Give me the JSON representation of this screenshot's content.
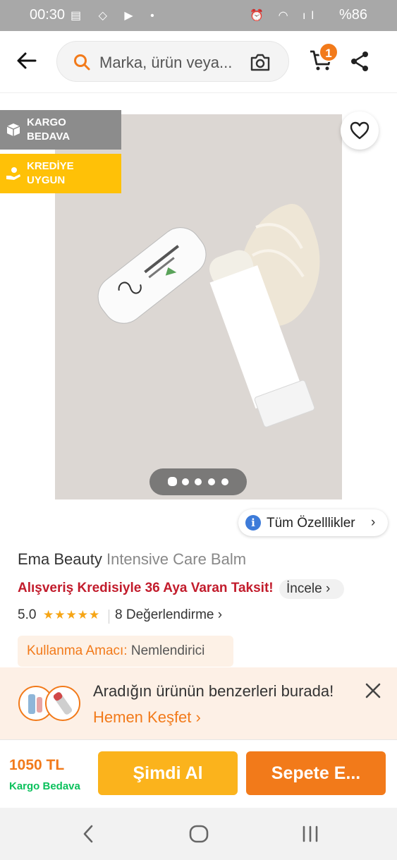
{
  "status_bar": {
    "time": "00:30",
    "battery": "%86"
  },
  "search": {
    "placeholder": "Marka, ürün veya..."
  },
  "cart": {
    "count": "1"
  },
  "badges": {
    "free_shipping_line1": "KARGO",
    "free_shipping_line2": "BEDAVA",
    "credit_line1": "KREDİYE",
    "credit_line2": "UYGUN"
  },
  "gallery": {
    "image_count": 5,
    "active_index": 0
  },
  "features_button": "Tüm Özelllikler",
  "product": {
    "brand": "Ema Beauty",
    "name": "Intensive Care Balm",
    "credit_text": "Alışveriş Kredisiyle 36 Aya Varan Taksit!",
    "incele": "İncele",
    "rating": "5.0",
    "stars": "★★★★★",
    "reviews": "8 Değerlendirme",
    "usage_label": "Kullanma Amacı:",
    "usage_value": "Nemlendirici"
  },
  "similar": {
    "title": "Aradığın ürünün benzerleri burada!",
    "link": "Hemen Keşfet"
  },
  "bottom": {
    "price": "1050 TL",
    "shipping": "Kargo Bedava",
    "buy_now": "Şimdi Al",
    "add_to_cart": "Sepete E..."
  },
  "colors": {
    "brand_orange": "#f27a1a",
    "buy_yellow": "#fbb31c",
    "shipping_green": "#0bc15c",
    "credit_red": "#c21c2c",
    "badge_gray": "#8c8c8c",
    "badge_yellow": "#ffc107"
  }
}
